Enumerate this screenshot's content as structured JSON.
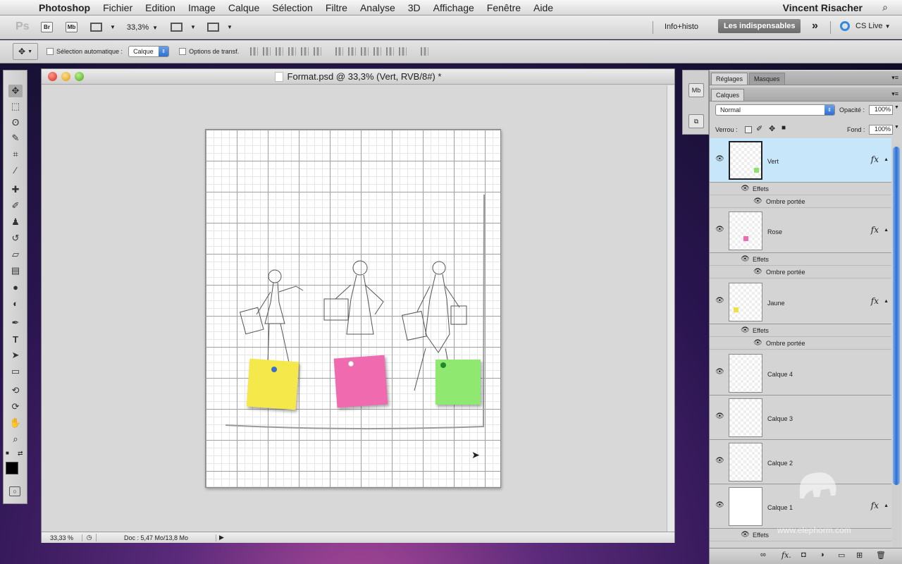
{
  "menubar": {
    "apple_icon": "",
    "app_name": "Photoshop",
    "menus": [
      "Fichier",
      "Edition",
      "Image",
      "Calque",
      "Sélection",
      "Filtre",
      "Analyse",
      "3D",
      "Affichage",
      "Fenêtre",
      "Aide"
    ],
    "user": "Vincent Risacher",
    "search_icon": "⌕"
  },
  "appbar": {
    "logo": "Ps",
    "bridge": "Br",
    "minibridge": "Mb",
    "zoom": "33,3%",
    "workspace_info": "Info+histo",
    "workspace_active": "Les indispensables",
    "more": "»",
    "cslive": "CS Live"
  },
  "options": {
    "auto_select_label": "Sélection automatique :",
    "auto_select_value": "Calque",
    "transform_label": "Options de transf."
  },
  "document": {
    "title": "Format.psd @ 33,3% (Vert, RVB/8#) *",
    "status_zoom": "33,33 %",
    "status_doc": "Doc : 5,47 Mo/13,8 Mo"
  },
  "panels": {
    "tabs_top": [
      "Réglages",
      "Masques"
    ],
    "tab_layers": "Calques",
    "blend_mode": "Normal",
    "opacity_label": "Opacité :",
    "opacity_value": "100%",
    "lock_label": "Verrou :",
    "fill_label": "Fond :",
    "fill_value": "100%",
    "layers": [
      {
        "name": "Vert",
        "fx": "fx",
        "effects": "Effets",
        "effect": "Ombre portée",
        "color": "#8de06a"
      },
      {
        "name": "Rose",
        "fx": "fx",
        "effects": "Effets",
        "effect": "Ombre portée",
        "color": "#f06ab0"
      },
      {
        "name": "Jaune",
        "fx": "fx",
        "effects": "Effets",
        "effect": "Ombre portée",
        "color": "#f0e040"
      },
      {
        "name": "Calque 4"
      },
      {
        "name": "Calque 3"
      },
      {
        "name": "Calque 2"
      },
      {
        "name": "Calque 1",
        "fx": "fx",
        "effects": "Effets"
      }
    ]
  },
  "watermark": "www.elephorm.com",
  "colors": {
    "accent": "#2f6fd0",
    "selected_layer": "#c8e6fa",
    "note_yellow": "#f5e84a",
    "note_pink": "#f06ab0",
    "note_green": "#8fe870"
  }
}
